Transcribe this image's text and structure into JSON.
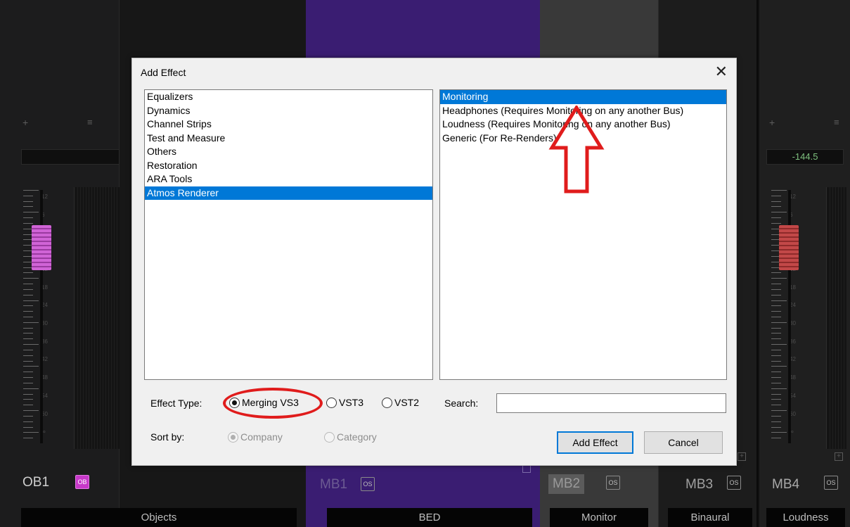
{
  "mixer": {
    "ob1": {
      "name": "OB1",
      "badge": "OB",
      "footer": "Objects"
    },
    "mb1": {
      "name": "MB1",
      "badge": "OS",
      "footer": "BED"
    },
    "mb2": {
      "name": "MB2",
      "badge": "OS",
      "footer": "Monitor"
    },
    "mb3": {
      "name": "MB3",
      "badge": "OS",
      "footer": "Binaural"
    },
    "mb4": {
      "name": "MB4",
      "badge": "OS",
      "footer": "Loudness",
      "db_readout": "-144.5"
    },
    "plus_icon": "+",
    "menu_icon": "≡",
    "scale_labels": [
      "12",
      "6",
      "0",
      "6",
      "12",
      "18",
      "24",
      "30",
      "36",
      "42",
      "48",
      "54",
      "60",
      "∞"
    ],
    "colors": {
      "bed_strip": "#3a1d72",
      "ob_badge": "#c738c9",
      "fader_pink": "#d064d6",
      "fader_red": "#c24848",
      "db_readout": "#7ec07e"
    }
  },
  "dialog": {
    "title": "Add Effect",
    "close_glyph": "✕",
    "categories": [
      "Equalizers",
      "Dynamics",
      "Channel Strips",
      "Test and Measure",
      "Others",
      "Restoration",
      "ARA Tools",
      "Atmos Renderer"
    ],
    "selected_category": "Atmos Renderer",
    "effects": [
      "Monitoring",
      "Headphones (Requires Monitoring on any another Bus)",
      "Loudness (Requires Monitoring on any another Bus)",
      "Generic (For Re-Renders)"
    ],
    "selected_effect": "Monitoring",
    "effect_type_label": "Effect Type:",
    "effect_types": [
      {
        "label": "Merging VS3",
        "checked": true
      },
      {
        "label": "VST3",
        "checked": false
      },
      {
        "label": "VST2",
        "checked": false
      }
    ],
    "search_label": "Search:",
    "search_value": "",
    "sort_by_label": "Sort by:",
    "sort_options": [
      {
        "label": "Company",
        "checked": true,
        "disabled": true
      },
      {
        "label": "Category",
        "checked": false,
        "disabled": true
      }
    ],
    "add_button": "Add Effect",
    "cancel_button": "Cancel",
    "selection_color": "#0078d7"
  },
  "annotations": {
    "color": "#e01c1c",
    "ellipse_target": "Merging VS3",
    "arrow_target": "Monitoring"
  }
}
